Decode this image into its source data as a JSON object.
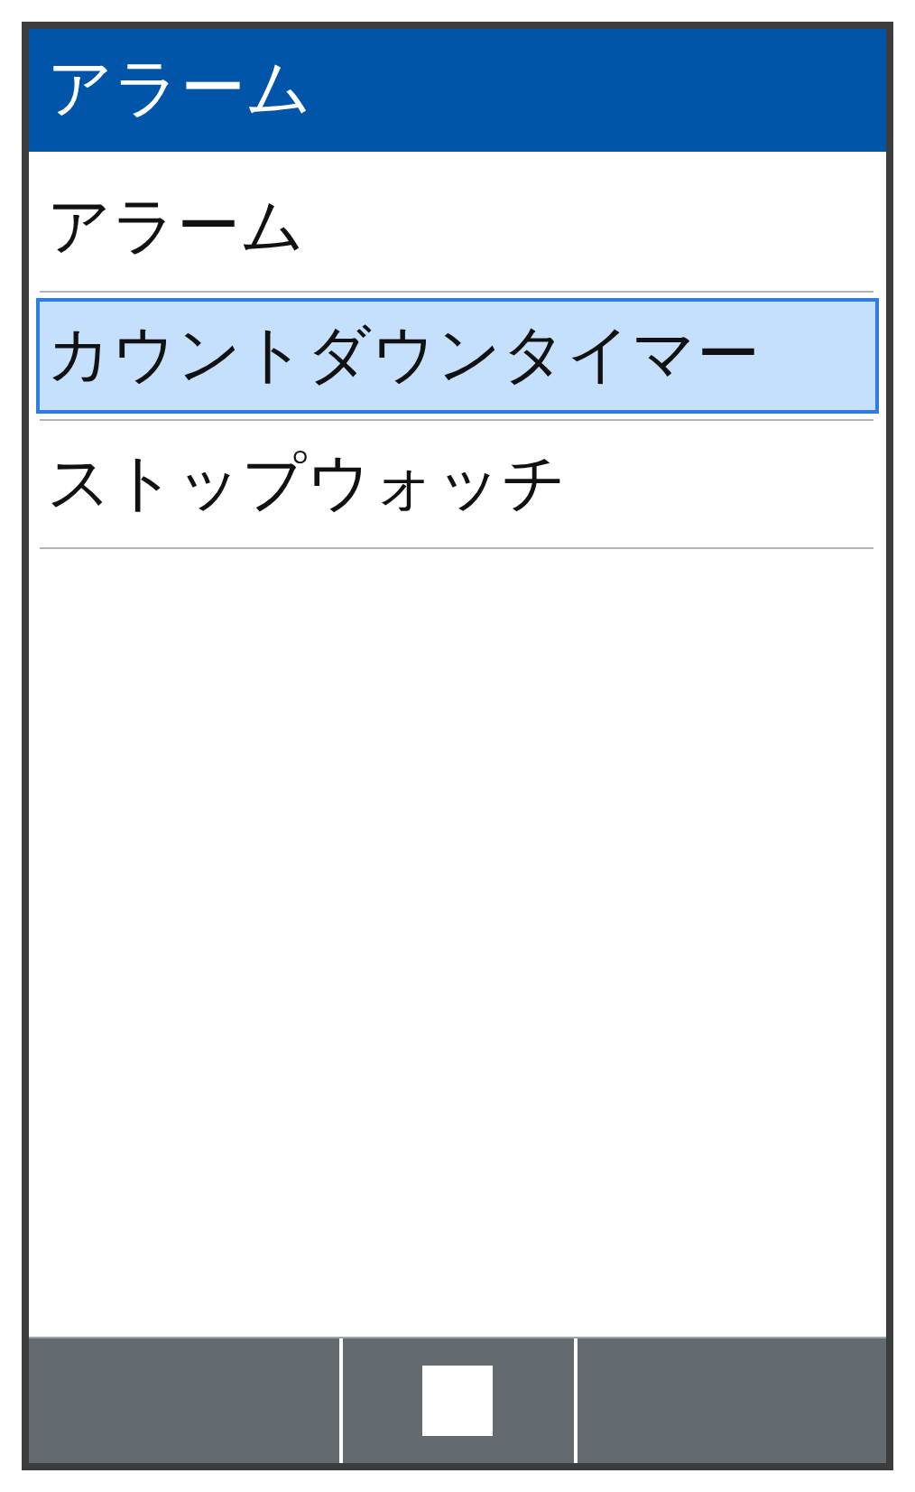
{
  "header": {
    "title": "アラーム"
  },
  "items": [
    {
      "label": "アラーム",
      "selected": false
    },
    {
      "label": "カウントダウンタイマー",
      "selected": true
    },
    {
      "label": "ストップウォッチ",
      "selected": false
    }
  ],
  "softkeys": [
    {
      "kind": "blank"
    },
    {
      "kind": "square"
    },
    {
      "kind": "blank"
    }
  ]
}
